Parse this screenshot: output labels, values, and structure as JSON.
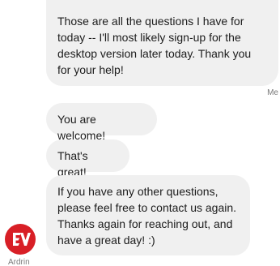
{
  "messages": {
    "me": {
      "text": "Those are all the questions I have for today -- I'll most likely sign-up for the desktop version later today. Thank you for your help!",
      "sender": "Me"
    },
    "agent": [
      {
        "text": "You are welcome!"
      },
      {
        "text": "That's great!"
      },
      {
        "text": "If you have any other questions, please feel free to contact us again. Thanks again for reaching out, and have a great day! :)"
      }
    ],
    "agent_sender": "Ardrin"
  },
  "colors": {
    "bubble": "#f0f0f0",
    "avatar": "#d81f26"
  },
  "icons": {
    "avatar": "expressvpn-logo-icon"
  }
}
